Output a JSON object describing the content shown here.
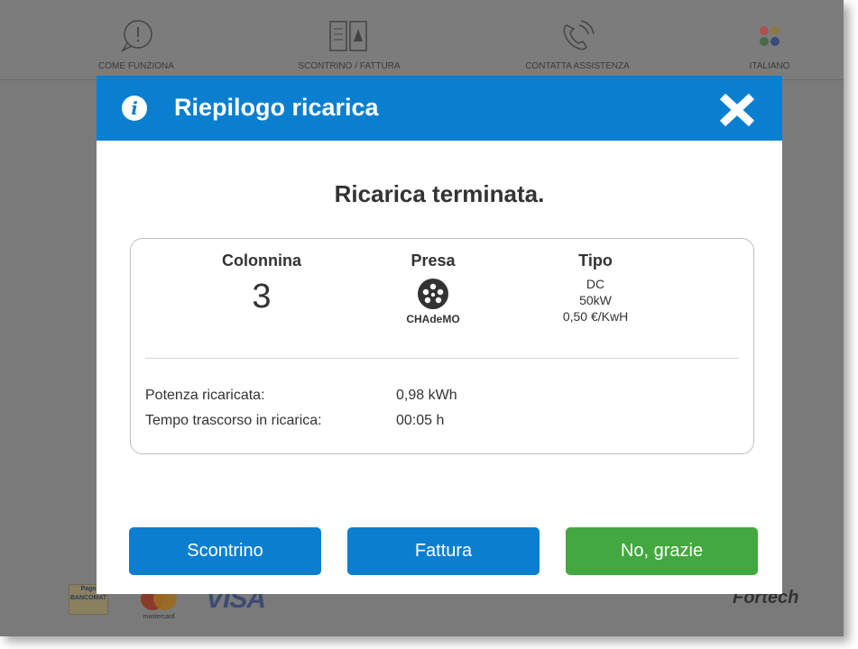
{
  "nav": [
    {
      "label": "COME FUNZIONA",
      "icon": "alert-bubble-icon"
    },
    {
      "label": "SCONTRINO / FATTURA",
      "icon": "receipt-icon"
    },
    {
      "label": "CONTATTA ASSISTENZA",
      "icon": "phone-icon"
    },
    {
      "label": "ITALIANO",
      "icon": "flags-icon"
    }
  ],
  "modal": {
    "title": "Riepilogo ricarica",
    "status": "Ricarica terminata.",
    "colonnina": {
      "label": "Colonnina",
      "value": "3"
    },
    "presa": {
      "label": "Presa",
      "plug": "CHAdeMO"
    },
    "tipo": {
      "label": "Tipo",
      "current": "DC",
      "power": "50kW",
      "price": "0,50 €/KwH"
    },
    "potenza": {
      "label": "Potenza ricaricata:",
      "value": "0,98 kWh"
    },
    "tempo": {
      "label": "Tempo trascorso in ricarica:",
      "value": "00:05 h"
    },
    "buttons": {
      "scontrino": "Scontrino",
      "fattura": "Fattura",
      "no": "No, grazie"
    }
  },
  "payments": {
    "bancomat_lines": [
      "Pago",
      "BANCOMAT"
    ],
    "mastercard": "mastercard",
    "visa": "VISA",
    "brand": "Fortech"
  },
  "colors": {
    "primary": "#0a7fd0",
    "success": "#43a83f",
    "overlay": "#7a7a7a"
  }
}
